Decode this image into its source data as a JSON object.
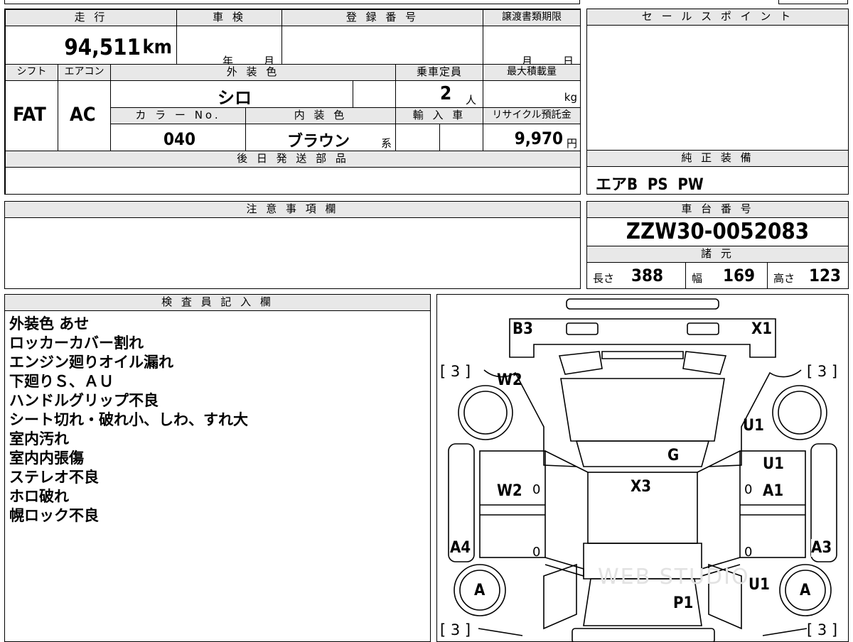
{
  "summary": {
    "mileage": {
      "label": "走 行",
      "value": "94,511",
      "unit": "km"
    },
    "inspection": {
      "label": "車 検",
      "year_unit": "年",
      "month_unit": "月"
    },
    "registration": {
      "label": "登 録 番 号"
    },
    "transfer_deadline": {
      "label": "譲渡書類期限",
      "month_unit": "月",
      "day_unit": "日"
    },
    "shift": {
      "label": "シフト",
      "value": "FAT"
    },
    "aircon": {
      "label": "エアコン",
      "value": "AC"
    },
    "exterior_color": {
      "label": "外 装 色",
      "value": "シロ"
    },
    "capacity": {
      "label": "乗車定員",
      "value": "2",
      "unit": "人"
    },
    "max_load": {
      "label": "最大積載量",
      "unit": "kg"
    },
    "color_no": {
      "label": "カ ラ ー No.",
      "value": "040"
    },
    "interior_color": {
      "label": "内 装 色",
      "value": "ブラウン",
      "suffix": "系"
    },
    "import": {
      "label": "輸 入 車"
    },
    "recycle": {
      "label": "リサイクル預託金",
      "value": "9,970",
      "unit": "円"
    },
    "later_parts": {
      "label": "後 日 発 送 部 品"
    }
  },
  "sales_point": {
    "label": "セ ー ル ス ポ イ ン ト"
  },
  "equipment": {
    "label": "純 正 装 備",
    "value": "エアB  PS  PW"
  },
  "notes": {
    "label": "注 意 事 項 欄"
  },
  "chassis": {
    "label": "車 台 番 号",
    "value": "ZZW30-0052083"
  },
  "specs": {
    "label": "諸 元",
    "length": {
      "label": "長さ",
      "value": "388"
    },
    "width": {
      "label": "幅",
      "value": "169"
    },
    "height": {
      "label": "高さ",
      "value": "123"
    }
  },
  "inspector": {
    "label": "検 査 員 記 入 欄",
    "lines": [
      "外装色 あせ",
      "ロッカーカバー割れ",
      "エンジン廻りオイル漏れ",
      "下廻りＳ、ＡＵ",
      "ハンドルグリップ不良",
      "シート切れ・破れ小、しわ、すれ大",
      "室内汚れ",
      "室内内張傷",
      "ステレオ不良",
      "ホロ破れ",
      "幌ロック不良"
    ]
  },
  "diagram": {
    "marks": {
      "b3": "B3",
      "x1": "X1",
      "w2_top": "W2",
      "u1_right": "U1",
      "g": "G",
      "u1_mid": "U1",
      "x3": "X3",
      "w2_mid": "W2",
      "a1": "A1",
      "a4": "A4",
      "a3": "A3",
      "tire_left": "A",
      "tire_right": "A",
      "u1_low": "U1",
      "p1": "P1"
    },
    "tread_tl": "[ 3 ]",
    "tread_tr": "[ 3 ]",
    "tread_bl": "[ 3 ]",
    "tread_br": "[ 3 ]",
    "zeros": [
      "0",
      "0",
      "0",
      "0"
    ],
    "watermark": "WEB STUDIO"
  }
}
